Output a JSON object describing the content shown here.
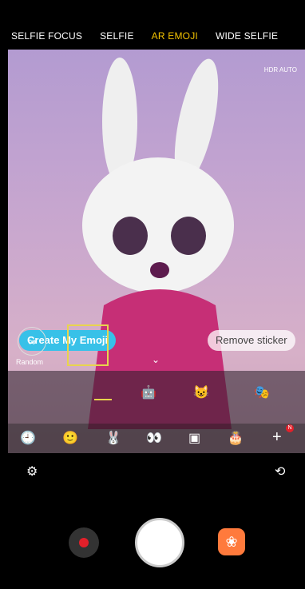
{
  "modes": [
    "SELFIE FOCUS",
    "SELFIE",
    "AR EMOJI",
    "WIDE SELFIE"
  ],
  "active_mode_index": 2,
  "hdr": "HDR AUTO",
  "buttons": {
    "create": "Create My Emoji",
    "remove": "Remove sticker"
  },
  "stickers": {
    "random_label": "Random"
  },
  "tabs": [
    "recent-icon",
    "face-icon",
    "bunny-icon",
    "mask-icon",
    "frame-icon",
    "birthday-icon",
    "add-icon"
  ],
  "badge": "N"
}
